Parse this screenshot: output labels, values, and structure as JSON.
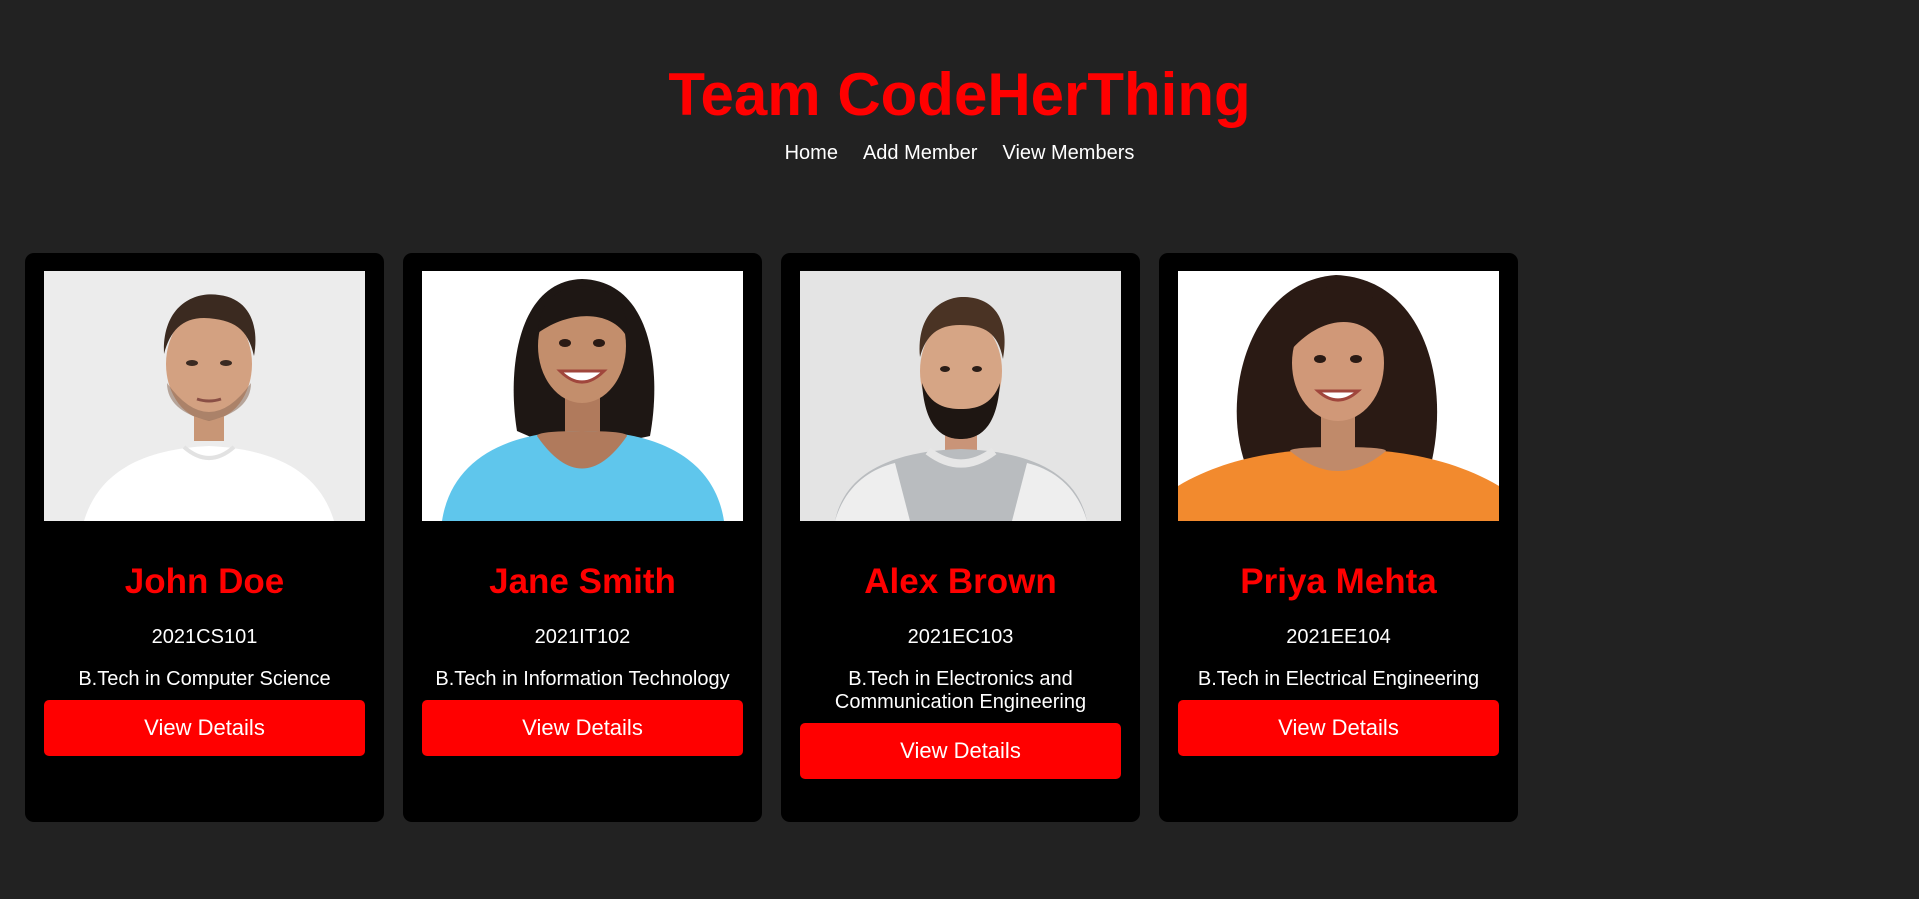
{
  "header": {
    "title": "Team CodeHerThing"
  },
  "nav": {
    "home": "Home",
    "add_member": "Add Member",
    "view_members": "View Members"
  },
  "members": [
    {
      "name": "John Doe",
      "roll": "2021CS101",
      "course": "B.Tech in Computer Science",
      "button": "View Details",
      "photo_alt": "John Doe",
      "shirt_color": "#ffffff"
    },
    {
      "name": "Jane Smith",
      "roll": "2021IT102",
      "course": "B.Tech in Information Technology",
      "button": "View Details",
      "photo_alt": "Jane Smith",
      "shirt_color": "#5fc6ec"
    },
    {
      "name": "Alex Brown",
      "roll": "2021EC103",
      "course": "B.Tech in Electronics and Communication Engineering",
      "button": "View Details",
      "photo_alt": "Alex Brown",
      "shirt_color": "#b9bcbf"
    },
    {
      "name": "Priya Mehta",
      "roll": "2021EE104",
      "course": "B.Tech in Electrical Engineering",
      "button": "View Details",
      "photo_alt": "Priya Mehta",
      "shirt_color": "#f28a2e"
    }
  ],
  "colors": {
    "background": "#222222",
    "card": "#000000",
    "accent": "#ff0000",
    "text": "#ffffff"
  }
}
